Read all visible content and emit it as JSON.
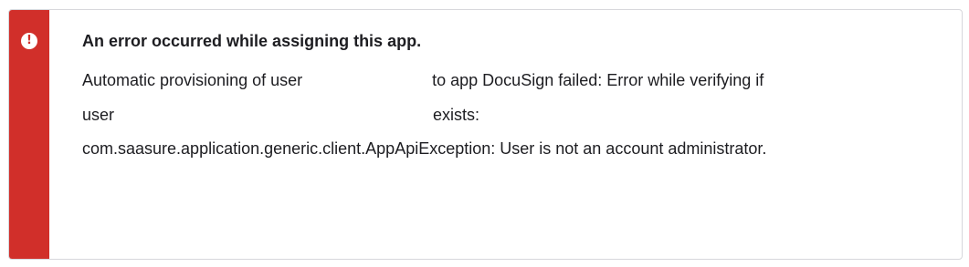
{
  "alert": {
    "title": "An error occurred while assigning this app.",
    "icon": "error-exclamation-icon",
    "icon_glyph": "!",
    "accent_color": "#d12f2a",
    "message": {
      "part1": "Automatic provisioning of user",
      "part2": "to app DocuSign failed: Error while verifying if",
      "part3": "user",
      "part4": "exists:",
      "part5": "com.saasure.application.generic.client.AppApiException: User is not an account administrator."
    }
  }
}
